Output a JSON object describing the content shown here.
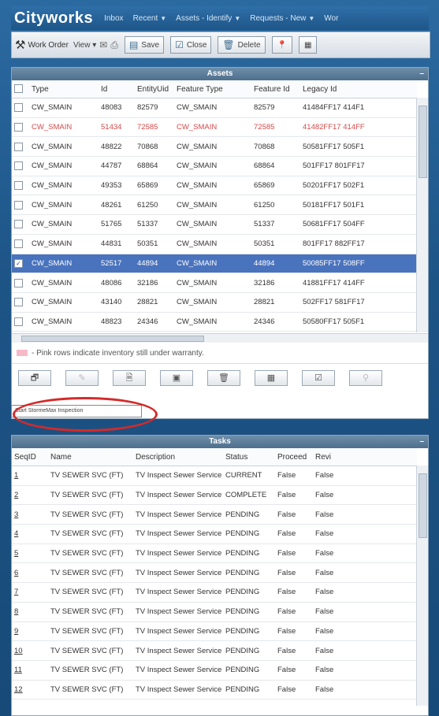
{
  "app": {
    "logo": "Cityworks",
    "nav": [
      "Inbox",
      "Recent",
      "Assets - Identify",
      "Requests - New",
      "Wor"
    ]
  },
  "toolbar": {
    "title": "Work Order",
    "view": "View",
    "save": "Save",
    "close": "Close",
    "delete": "Delete"
  },
  "assets": {
    "title": "Assets",
    "columns": [
      "Type",
      "Id",
      "EntityUid",
      "Feature Type",
      "Feature Id",
      "Legacy Id"
    ],
    "rows": [
      [
        "CW_SMAIN",
        "48083",
        "82579",
        "CW_SMAIN",
        "82579",
        "41484FF17 414F1"
      ],
      [
        "CW_SMAIN",
        "51434",
        "72585",
        "CW_SMAIN",
        "72585",
        "41482FF17 414FF"
      ],
      [
        "CW_SMAIN",
        "48822",
        "70868",
        "CW_SMAIN",
        "70868",
        "50581FF17 505F1"
      ],
      [
        "CW_SMAIN",
        "44787",
        "68864",
        "CW_SMAIN",
        "68864",
        "501FF17 801FF17"
      ],
      [
        "CW_SMAIN",
        "49353",
        "65869",
        "CW_SMAIN",
        "65869",
        "50201FF17 502F1"
      ],
      [
        "CW_SMAIN",
        "48261",
        "61250",
        "CW_SMAIN",
        "61250",
        "50181FF17 501F1"
      ],
      [
        "CW_SMAIN",
        "51765",
        "51337",
        "CW_SMAIN",
        "51337",
        "50681FF17 504FF"
      ],
      [
        "CW_SMAIN",
        "44831",
        "50351",
        "CW_SMAIN",
        "50351",
        "801FF17 882FF17"
      ],
      [
        "CW_SMAIN",
        "52517",
        "44894",
        "CW_SMAIN",
        "44894",
        "50085FF17 508FF"
      ],
      [
        "CW_SMAIN",
        "48086",
        "32186",
        "CW_SMAIN",
        "32186",
        "41881FF17 414FF"
      ],
      [
        "CW_SMAIN",
        "43140",
        "28821",
        "CW_SMAIN",
        "28821",
        "502FF17 581FF17"
      ],
      [
        "CW_SMAIN",
        "48823",
        "24346",
        "CW_SMAIN",
        "24346",
        "50580FF17 505F1"
      ]
    ],
    "legend": "- Pink rows indicate inventory still under warranty.",
    "tooltip": "Start StormeMax Inspection"
  },
  "tasks": {
    "title": "Tasks",
    "columns": [
      "SeqID",
      "Name",
      "Description",
      "Status",
      "Proceed",
      "Revi"
    ],
    "rows": [
      [
        "1",
        "TV SEWER SVC (FT)",
        "TV Inspect Sewer Service",
        "CURRENT",
        "False",
        "False"
      ],
      [
        "2",
        "TV SEWER SVC (FT)",
        "TV Inspect Sewer Service",
        "COMPLETE",
        "False",
        "False"
      ],
      [
        "3",
        "TV SEWER SVC (FT)",
        "TV Inspect Sewer Service",
        "PENDING",
        "False",
        "False"
      ],
      [
        "4",
        "TV SEWER SVC (FT)",
        "TV Inspect Sewer Service",
        "PENDING",
        "False",
        "False"
      ],
      [
        "5",
        "TV SEWER SVC (FT)",
        "TV Inspect Sewer Service",
        "PENDING",
        "False",
        "False"
      ],
      [
        "6",
        "TV SEWER SVC (FT)",
        "TV Inspect Sewer Service",
        "PENDING",
        "False",
        "False"
      ],
      [
        "7",
        "TV SEWER SVC (FT)",
        "TV Inspect Sewer Service",
        "PENDING",
        "False",
        "False"
      ],
      [
        "8",
        "TV SEWER SVC (FT)",
        "TV Inspect Sewer Service",
        "PENDING",
        "False",
        "False"
      ],
      [
        "9",
        "TV SEWER SVC (FT)",
        "TV Inspect Sewer Service",
        "PENDING",
        "False",
        "False"
      ],
      [
        "10",
        "TV SEWER SVC (FT)",
        "TV Inspect Sewer Service",
        "PENDING",
        "False",
        "False"
      ],
      [
        "11",
        "TV SEWER SVC (FT)",
        "TV Inspect Sewer Service",
        "PENDING",
        "False",
        "False"
      ],
      [
        "12",
        "TV SEWER SVC (FT)",
        "TV Inspect Sewer Service",
        "PENDING",
        "False",
        "False"
      ]
    ]
  },
  "colors": {
    "warranty_row": "#d64a4a",
    "selected_row": "#4a73bd",
    "highlight_ring": "#d42a2a"
  }
}
